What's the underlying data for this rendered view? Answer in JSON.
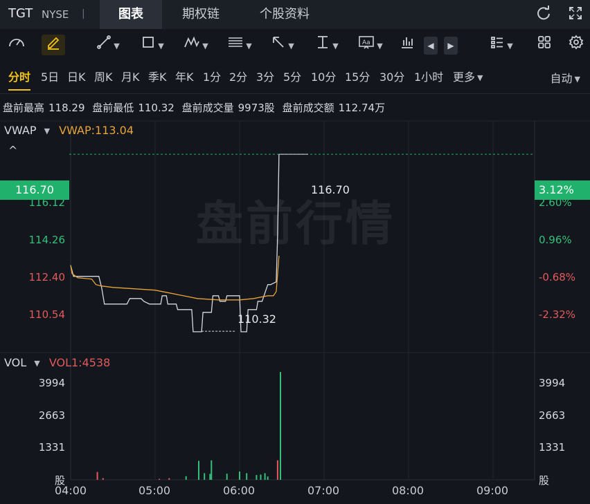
{
  "header": {
    "symbol": "TGT",
    "exchange": "NYSE",
    "separator": "|",
    "tabs": [
      {
        "label": "图表",
        "active": true
      },
      {
        "label": "期权链",
        "active": false
      },
      {
        "label": "个股资料",
        "active": false
      }
    ],
    "icons": [
      "refresh-icon",
      "fullscreen-icon"
    ]
  },
  "toolbar": {
    "tools": [
      "speedometer-icon",
      "pencil-icon",
      "trend-line-icon",
      "rectangle-icon",
      "pattern-icon",
      "fibonacci-icon",
      "arrow-icon",
      "vertical-measure-icon",
      "text-icon",
      "indicator-icon",
      "prev-icon",
      "next-icon",
      "list-icon",
      "grid-icon",
      "settings-icon"
    ]
  },
  "periods": {
    "items": [
      "分时",
      "5日",
      "日K",
      "周K",
      "月K",
      "季K",
      "年K",
      "1分",
      "2分",
      "3分",
      "5分",
      "10分",
      "15分",
      "30分",
      "1小时",
      "更多"
    ],
    "active": "分时",
    "scale_mode": "自动"
  },
  "stats": {
    "high_label": "盘前最高",
    "high_value": "118.29",
    "low_label": "盘前最低",
    "low_value": "110.32",
    "volume_label": "盘前成交量",
    "volume_value": "9973股",
    "amount_label": "盘前成交额",
    "amount_value": "112.74万"
  },
  "price_panel": {
    "indicator": "VWAP",
    "indicator_value": "VWAP:113.04",
    "watermark": "盘前行情",
    "current_price": "116.70",
    "current_pct": "3.12%",
    "low_annotation": "110.32",
    "high_annotation": "116.70",
    "left_ticks": [
      "116.12",
      "114.26",
      "112.40",
      "110.54"
    ],
    "right_ticks": [
      "2.60%",
      "0.96%",
      "-0.68%",
      "-2.32%"
    ]
  },
  "volume_panel": {
    "indicator": "VOL",
    "indicator_value": "VOL1:4538",
    "left_ticks": [
      "3994",
      "2663",
      "1331",
      "股"
    ],
    "right_ticks": [
      "3994",
      "2663",
      "1331",
      "股"
    ]
  },
  "colors": {
    "up": "#35c07a",
    "down": "#e25b5b",
    "price_line": "#d7dae0",
    "vwap_line": "#e8a43a",
    "accent": "#f2c318"
  },
  "chart_data": [
    {
      "type": "line",
      "x_labels": [
        "04:00",
        "05:00",
        "06:00",
        "07:00",
        "08:00",
        "09:00"
      ],
      "ylim": [
        109.6,
        117.9
      ],
      "series": [
        {
          "name": "",
          "color": "#d7dae0",
          "points": [
            [
              "04:00",
              112.7
            ],
            [
              "04:02",
              112.3
            ],
            [
              "04:04",
              112.3
            ],
            [
              "04:20",
              112.3
            ],
            [
              "04:22",
              111.9
            ],
            [
              "04:24",
              111.3
            ],
            [
              "04:40",
              111.3
            ],
            [
              "04:42",
              111.5
            ],
            [
              "04:44",
              111.5
            ],
            [
              "04:50",
              111.5
            ],
            [
              "04:52",
              111.4
            ],
            [
              "04:56",
              111.3
            ],
            [
              "05:00",
              111.3
            ],
            [
              "05:04",
              111.3
            ],
            [
              "05:05",
              111.6
            ],
            [
              "05:08",
              111.6
            ],
            [
              "05:09",
              111.3
            ],
            [
              "05:15",
              111.3
            ],
            [
              "05:16",
              111.1
            ],
            [
              "05:26",
              111.1
            ],
            [
              "05:27",
              110.3
            ],
            [
              "05:33",
              110.3
            ],
            [
              "05:34",
              111.0
            ],
            [
              "05:40",
              111.0
            ],
            [
              "05:41",
              111.6
            ],
            [
              "05:45",
              111.6
            ],
            [
              "05:46",
              111.4
            ],
            [
              "05:50",
              111.4
            ],
            [
              "05:51",
              111.6
            ],
            [
              "06:00",
              111.6
            ],
            [
              "06:01",
              110.3
            ],
            [
              "06:05",
              110.3
            ],
            [
              "06:06",
              111.1
            ],
            [
              "06:12",
              111.1
            ],
            [
              "06:13",
              111.4
            ],
            [
              "06:16",
              111.4
            ],
            [
              "06:18",
              111.7
            ],
            [
              "06:20",
              112.0
            ],
            [
              "06:22",
              112.0
            ],
            [
              "06:26",
              112.1
            ],
            [
              "06:27",
              113.8
            ],
            [
              "06:28",
              116.7
            ]
          ]
        },
        {
          "name": "VWAP",
          "color": "#e8a43a",
          "points": [
            [
              "04:00",
              112.7
            ],
            [
              "04:01",
              112.4
            ],
            [
              "04:05",
              112.25
            ],
            [
              "04:15",
              112.2
            ],
            [
              "04:18",
              112.0
            ],
            [
              "04:22",
              111.95
            ],
            [
              "04:30",
              111.9
            ],
            [
              "04:45",
              111.85
            ],
            [
              "05:00",
              111.8
            ],
            [
              "05:10",
              111.7
            ],
            [
              "05:20",
              111.6
            ],
            [
              "05:30",
              111.5
            ],
            [
              "05:45",
              111.45
            ],
            [
              "06:00",
              111.45
            ],
            [
              "06:10",
              111.5
            ],
            [
              "06:20",
              111.6
            ],
            [
              "06:24",
              111.6
            ],
            [
              "06:26",
              111.75
            ],
            [
              "06:27",
              112.4
            ],
            [
              "06:28",
              113.04
            ]
          ]
        }
      ]
    },
    {
      "type": "bar",
      "name": "VOL",
      "ylim": [
        0,
        4600
      ],
      "bars": [
        {
          "t": "04:19",
          "v": 330,
          "dir": "down"
        },
        {
          "t": "04:23",
          "v": 70,
          "dir": "down"
        },
        {
          "t": "05:03",
          "v": 40,
          "dir": "down"
        },
        {
          "t": "05:10",
          "v": 70,
          "dir": "down"
        },
        {
          "t": "05:22",
          "v": 150,
          "dir": "up"
        },
        {
          "t": "05:31",
          "v": 800,
          "dir": "up"
        },
        {
          "t": "05:35",
          "v": 280,
          "dir": "up"
        },
        {
          "t": "05:39",
          "v": 250,
          "dir": "up"
        },
        {
          "t": "05:40",
          "v": 820,
          "dir": "up"
        },
        {
          "t": "05:51",
          "v": 260,
          "dir": "up"
        },
        {
          "t": "06:00",
          "v": 350,
          "dir": "up"
        },
        {
          "t": "06:05",
          "v": 280,
          "dir": "up"
        },
        {
          "t": "06:12",
          "v": 200,
          "dir": "up"
        },
        {
          "t": "06:15",
          "v": 220,
          "dir": "up"
        },
        {
          "t": "06:18",
          "v": 280,
          "dir": "up"
        },
        {
          "t": "06:20",
          "v": 140,
          "dir": "up"
        },
        {
          "t": "06:27",
          "v": 820,
          "dir": "down"
        },
        {
          "t": "06:29",
          "v": 4538,
          "dir": "up"
        }
      ]
    }
  ]
}
